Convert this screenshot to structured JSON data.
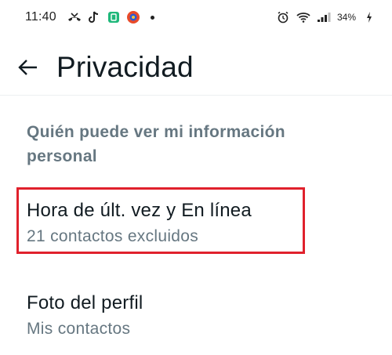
{
  "status_bar": {
    "time": "11:40",
    "battery_percent": "34%",
    "left_icons": [
      "missed-call-icon",
      "tiktok-icon",
      "app-icon",
      "game-icon",
      "more-notifications-dot"
    ],
    "right_icons": [
      "alarm-icon",
      "wifi-icon",
      "signal-icon",
      "battery-icon"
    ]
  },
  "header": {
    "title": "Privacidad"
  },
  "section": {
    "title": "Quién puede ver mi información personal"
  },
  "items": [
    {
      "title": "Hora de últ. vez y En línea",
      "subtitle": "21 contactos excluidos"
    },
    {
      "title": "Foto del perfil",
      "subtitle": "Mis contactos"
    }
  ],
  "colors": {
    "highlight": "#e0212c",
    "secondary_text": "#667781",
    "primary_text": "#111b21"
  }
}
